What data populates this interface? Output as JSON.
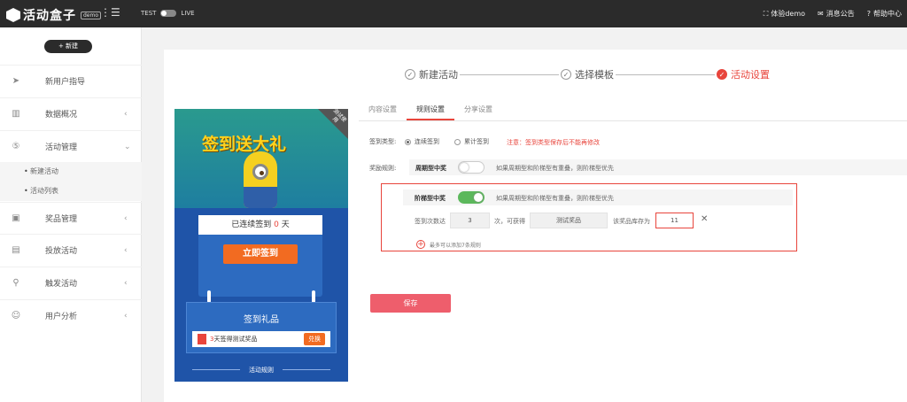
{
  "brand": {
    "name": "活动盒子",
    "badge": "demo"
  },
  "env": {
    "test": "TEST",
    "live": "LIVE"
  },
  "topnav": {
    "demo": "体验demo",
    "notice": "消息公告",
    "help": "帮助中心"
  },
  "sidebar": {
    "new_button": "+ 新建",
    "items": [
      {
        "label": "新用户指导",
        "icon": "paper-plane-icon"
      },
      {
        "label": "数据概况",
        "icon": "chart-icon"
      },
      {
        "label": "活动管理",
        "icon": "html5-icon"
      },
      {
        "label": "奖品管理",
        "icon": "gift-icon"
      },
      {
        "label": "投放活动",
        "icon": "image-icon"
      },
      {
        "label": "触发活动",
        "icon": "network-icon"
      },
      {
        "label": "用户分析",
        "icon": "user-icon"
      }
    ],
    "subitems": [
      "新建活动",
      "活动列表"
    ]
  },
  "steps": [
    "新建活动",
    "选择模板",
    "活动设置"
  ],
  "preview": {
    "title": "签到送大礼",
    "corner": "测试使用",
    "streak_prefix": "已连续签到",
    "streak_days": "0",
    "streak_suffix": "天",
    "sign_button": "立即签到",
    "gift_title": "签到礼品",
    "prize_days": "3",
    "prize_text": "天签得测试奖品",
    "prize_button": "兑换",
    "rules_title": "活动规则"
  },
  "tabs": [
    "内容设置",
    "规则设置",
    "分享设置"
  ],
  "settings": {
    "sign_type_label": "签到类型:",
    "radio_consecutive": "连续签到",
    "radio_cumulative": "累计签到",
    "warning": "注意：签到类型保存后不能再修改",
    "reward_label": "奖励规则:",
    "periodic_label": "周期型中奖",
    "periodic_hint": "如果周期型和阶梯型有重叠，则阶梯型优先",
    "tier_label": "阶梯型中奖",
    "tier_hint": "如果周期型和阶梯型有重叠，则阶梯型优先",
    "days_prefix": "签到次数达",
    "days_value": "3",
    "days_suffix": "次，可获得",
    "prize_value": "测试奖品",
    "stock_label": "该奖品库存为",
    "stock_value": "11",
    "add_rule": "最多可以添加7条规则",
    "save": "保存"
  }
}
